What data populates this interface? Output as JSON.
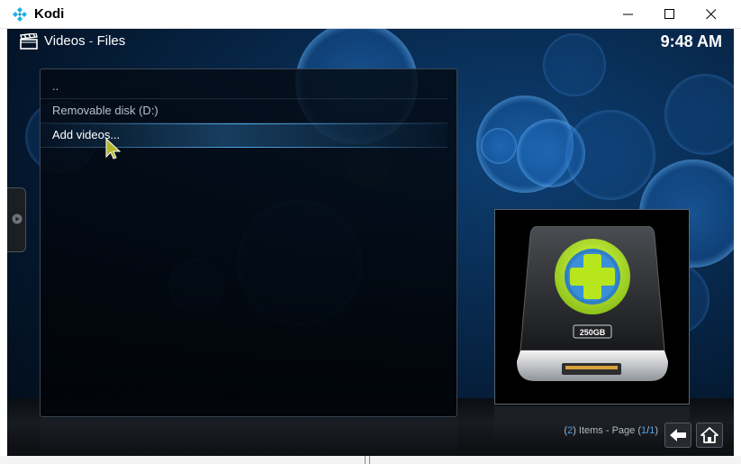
{
  "window": {
    "title": "Kodi",
    "icon": "kodi-logo-icon",
    "controls": [
      "minimize-icon",
      "maximize-icon",
      "close-icon"
    ]
  },
  "header": {
    "icon": "clapperboard-icon",
    "section": "Videos",
    "separator": "-",
    "subsection": "Files",
    "time": "9:48 AM"
  },
  "file_list": {
    "items": [
      {
        "label": "..",
        "focused": false
      },
      {
        "label": "Removable disk (D:)",
        "focused": false
      },
      {
        "label": "Add videos...",
        "focused": true
      }
    ]
  },
  "thumbnail": {
    "icon": "add-drive-icon",
    "capacity_label": "250GB"
  },
  "footer": {
    "items_count": "2",
    "items_text": " Items - Page ",
    "page_current": "1",
    "page_total": "1",
    "back_icon": "back-arrow-icon",
    "home_icon": "home-icon"
  },
  "colors": {
    "accent": "#4e9fe8",
    "plus_green": "#b8e61c",
    "plus_blue": "#2f7fc4",
    "background_blue": "#0d3f73"
  }
}
